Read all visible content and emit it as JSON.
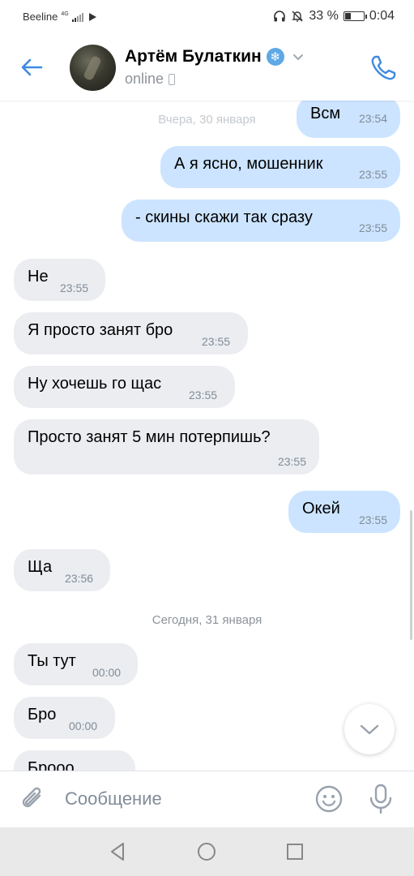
{
  "status_bar": {
    "carrier": "Beeline",
    "network": "4G",
    "battery_percent": "33 %",
    "battery_level": 0.33,
    "time": "0:04"
  },
  "header": {
    "contact_name": "Артём Булаткин",
    "verified_icon": "snowflake-badge-icon",
    "online_status": "online",
    "colors": {
      "accent": "#3f8ae0"
    }
  },
  "chat": {
    "messages": [
      {
        "dir": "out",
        "text": "Всм",
        "time": "23:54"
      },
      {
        "dir": "out",
        "text": "А я ясно, мошенник",
        "time": "23:55"
      },
      {
        "dir": "out",
        "text": "- скины скажи так сразу",
        "time": "23:55"
      },
      {
        "dir": "in",
        "text": "Не",
        "time": "23:55"
      },
      {
        "dir": "in",
        "text": "Я просто занят бро",
        "time": "23:55"
      },
      {
        "dir": "in",
        "text": "Ну хочешь го щас",
        "time": "23:55"
      },
      {
        "dir": "in",
        "text": "Просто занят 5 мин потерпишь?",
        "time": "23:55"
      },
      {
        "dir": "out",
        "text": "Окей",
        "time": "23:55"
      },
      {
        "dir": "in",
        "text": "Ща",
        "time": "23:56"
      },
      {
        "dir": "in",
        "text": "Ты тут",
        "time": "00:00"
      },
      {
        "dir": "in",
        "text": "Бро",
        "time": "00:00"
      },
      {
        "dir": "in",
        "text": "Брооо",
        "time": ""
      }
    ],
    "date_separators": [
      "Вчера, 30 января",
      "Сегодня, 31 января"
    ],
    "colors": {
      "outgoing": "#cce4ff",
      "incoming": "#ebedf0"
    }
  },
  "composer": {
    "placeholder": "Сообщение"
  }
}
